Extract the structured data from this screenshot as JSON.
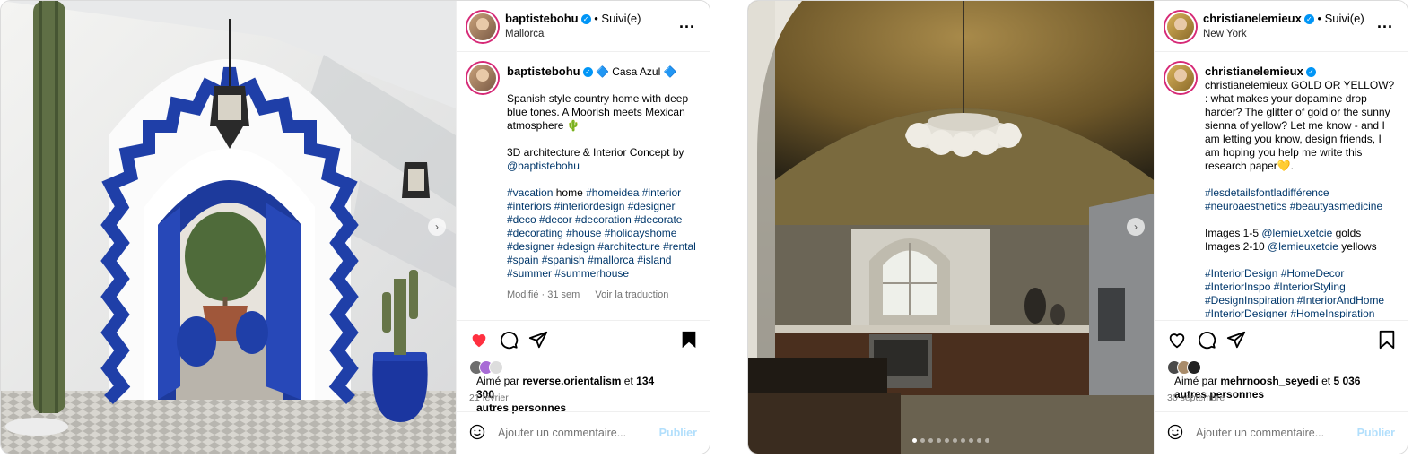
{
  "post1": {
    "header": {
      "username": "baptistebohu",
      "follow": "• Suivi(e)",
      "location": "Mallorca",
      "more": "..."
    },
    "caption": {
      "username": "baptistebohu",
      "title": "🔷 Casa Azul 🔷",
      "text": "Spanish style country home with deep blue tones. A Moorish meets Mexican atmosphere 🌵",
      "credit": "3D architecture & Interior Concept by",
      "mention": "@baptistebohu",
      "tags_1": "#vacation",
      "word_home": "home",
      "tags_2": "#homeidea #interior #interiors #interiordesign #designer #deco #decor #decoration #decorate #decorating #house #holidayshome #designer #design #architecture #rental #spain #spanish #mallorca #island #summer #summerhouse",
      "modified": "Modifié · 31 sem",
      "translate": "Voir la traduction"
    },
    "liked": true,
    "likes": {
      "prefix": "Aimé par",
      "user": "reverse.orientalism",
      "mid": "et",
      "count": "134 300",
      "suffix": "autres personnes"
    },
    "date": "21 février",
    "comment": {
      "placeholder": "Ajouter un commentaire...",
      "publish": "Publier"
    }
  },
  "post2": {
    "header": {
      "username": "christianelemieux",
      "follow": "• Suivi(e)",
      "location": "New York",
      "more": "..."
    },
    "caption": {
      "username": "christianelemieux",
      "lead": "christianelemieux GOLD OR YELLOW? : what makes your dopamine drop harder? The glitter of gold or the sunny sienna of yellow? Let me know - and I am letting you know, design friends, I am hoping you help me write this research paper💛.",
      "tags_a": "#lesdetailsfontladifférence #neuroaesthetics #beautyasmedicine",
      "img1_text": "Images 1-5",
      "img1_mention": "@lemieuxetcie",
      "img1_suffix": "golds",
      "img2_text": "Images 2-10",
      "img2_mention": "@lemieuxetcie",
      "img2_suffix": "yellows",
      "tags_b": "#InteriorDesign #HomeDecor #InteriorInspo #InteriorStyling #DesignInspiration #InteriorAndHome #InteriorDesigner #HomeInspiration #Interiors #InteriorGoals #Architecture"
    },
    "liked": false,
    "likes": {
      "prefix": "Aimé par",
      "user": "mehrnoosh_seyedi",
      "mid": "et",
      "count": "5 036",
      "suffix": "autres personnes"
    },
    "date": "30 septembre",
    "comment": {
      "placeholder": "Ajouter un commentaire...",
      "publish": "Publier"
    },
    "carousel": {
      "count": 10,
      "active": 0
    }
  },
  "colors": {
    "like_red": "#ff3040",
    "link_blue": "#00376b",
    "verified_blue": "#0095f6"
  },
  "icons": [
    "heart-icon",
    "comment-icon",
    "share-icon",
    "bookmark-icon",
    "emoji-icon",
    "more-icon",
    "next-arrow-icon",
    "verified-icon"
  ]
}
